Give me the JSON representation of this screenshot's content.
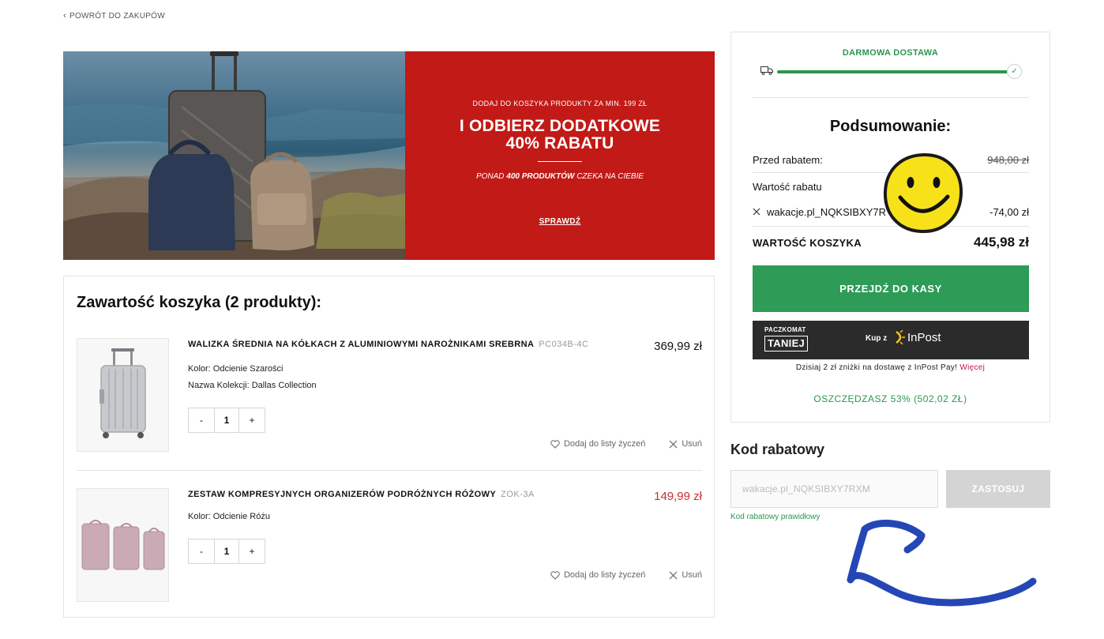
{
  "nav": {
    "back_label": "POWRÓT DO ZAKUPÓW"
  },
  "banner": {
    "small": "DODAJ DO KOSZYKA PRODUKTY ZA MIN. 199 ZŁ",
    "big_line1": "I ODBIERZ DODATKOWE",
    "big_line2": "40% RABATU",
    "sub_pre": "PONAD ",
    "sub_bold": "400 PRODUKTÓW",
    "sub_post": " CZEKA NA CIEBIE",
    "cta": "SPRAWDŹ"
  },
  "cart": {
    "title": "Zawartość koszyka (2 produkty):",
    "items": [
      {
        "name": "WALIZKA ŚREDNIA NA KÓŁKACH Z ALUMINIOWYMI NAROŻNIKAMI SREBRNA",
        "sku": "PC034B-4C",
        "price": "369,99 zł",
        "attr1": "Kolor: Odcienie Szarości",
        "attr2": "Nazwa Kolekcji: Dallas Collection",
        "qty": "1"
      },
      {
        "name": "ZESTAW KOMPRESYJNYCH ORGANIZERÓW PODRÓŻNYCH RÓŻOWY",
        "sku": "ZOK-3A",
        "price": "149,99 zł",
        "attr1": "Kolor: Odcienie Różu",
        "qty": "1"
      }
    ],
    "minus": "-",
    "plus": "+",
    "wishlist_label": "Dodaj do listy życzeń",
    "remove_label": "Usuń"
  },
  "summary": {
    "shipping_label": "DARMOWA DOSTAWA",
    "title": "Podsumowanie:",
    "before_label": "Przed rabatem:",
    "before_value": "948,00 zł",
    "discount_label": "Wartość rabatu",
    "code_applied": "wakacje.pl_NQKSIBXY7R",
    "code_value": "-74,00 zł",
    "total_label": "WARTOŚĆ KOSZYKA",
    "total_value": "445,98 zł",
    "checkout_label": "PRZEJDŹ DO KASY",
    "inpost_pkg": "PACZKOMAT",
    "inpost_taniej": "TANIEJ",
    "inpost_kupz": "Kup z",
    "inpost_brand": "InPost",
    "inpost_note": "Dzisiaj 2 zł zniżki na dostawę z InPost Pay!",
    "inpost_more": "Więcej",
    "savings": "OSZCZĘDZASZ 53% (502,02 ZŁ)"
  },
  "discount": {
    "title": "Kod rabatowy",
    "input_value": "wakacje.pl_NQKSIBXY7RXM",
    "apply_label": "ZASTOSUJ",
    "valid_msg": "Kod rabatowy prawidłowy"
  },
  "colors": {
    "accent_green": "#2e9b57",
    "promo_red": "#c11a17",
    "sale_red": "#c9302c",
    "link_pink": "#c2185b"
  }
}
